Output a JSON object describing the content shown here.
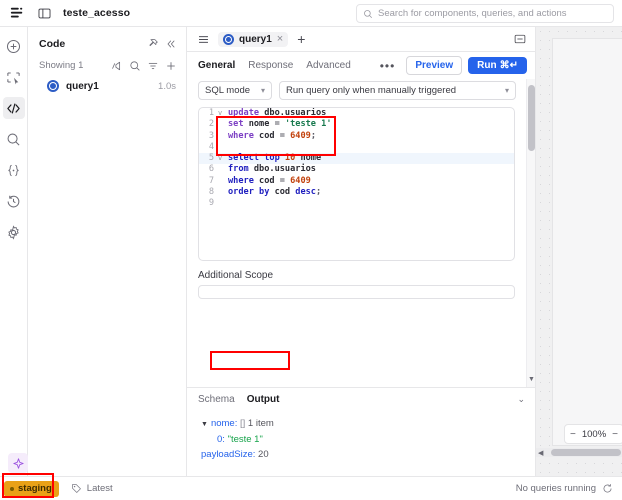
{
  "topbar": {
    "app_icon": "layers-icon",
    "panel_icon": "panel-toggle-icon",
    "title": "teste_acesso",
    "search_icon": "search-icon",
    "search_placeholder": "Search for components, queries, and actions"
  },
  "rail": {
    "items": [
      {
        "icon": "plus-circle-icon",
        "name": "add-component",
        "active": false
      },
      {
        "icon": "component-tree-icon",
        "name": "components",
        "active": false
      },
      {
        "icon": "code-brackets-icon",
        "name": "code",
        "active": true
      },
      {
        "icon": "search-icon",
        "name": "search",
        "active": false
      },
      {
        "icon": "state-braces-icon",
        "name": "state",
        "active": false
      },
      {
        "icon": "history-clock-icon",
        "name": "history",
        "active": false
      },
      {
        "icon": "gear-icon",
        "name": "settings",
        "active": false
      }
    ],
    "spark_icon": "ai-sparkle-icon"
  },
  "code_panel": {
    "title": "Code",
    "pin_icon": "pin-icon",
    "collapse_icon": "chevrons-left-icon",
    "showing_label": "Showing 1",
    "sub_icons": [
      "filter-off-icon",
      "search-icon",
      "sort-icon",
      "plus-icon"
    ],
    "items": [
      {
        "icon": "query-icon",
        "label": "query1",
        "time": "1.0s"
      }
    ]
  },
  "editor": {
    "hamburger_icon": "hamburger-icon",
    "tab": {
      "icon": "query-icon",
      "label": "query1",
      "close_icon": "close-icon"
    },
    "add_tab_icon": "plus-icon",
    "collapse_icon": "collapse-panel-icon",
    "subtabs": [
      {
        "label": "General",
        "active": true
      },
      {
        "label": "Response",
        "active": false
      },
      {
        "label": "Advanced",
        "active": false
      }
    ],
    "more_label": "•••",
    "preview_label": "Preview",
    "run_label": "Run",
    "run_shortcut": "⌘↵",
    "sql_mode_label": "SQL mode",
    "trigger_label": "Run query only when manually triggered",
    "additional_scope_label": "Additional Scope",
    "code_lines": [
      {
        "n": "1",
        "fold": "v",
        "highlight": false,
        "tokens": [
          {
            "t": "update ",
            "c": "k"
          },
          {
            "t": "dbo.usuarios",
            "c": "id"
          }
        ]
      },
      {
        "n": "2",
        "fold": "",
        "highlight": false,
        "tokens": [
          {
            "t": "set ",
            "c": "k"
          },
          {
            "t": "nome ",
            "c": "id"
          },
          {
            "t": "= ",
            "c": "op"
          },
          {
            "t": "'teste 1'",
            "c": "str"
          }
        ]
      },
      {
        "n": "3",
        "fold": "",
        "highlight": false,
        "tokens": [
          {
            "t": "where ",
            "c": "k"
          },
          {
            "t": "cod ",
            "c": "id"
          },
          {
            "t": "= ",
            "c": "op"
          },
          {
            "t": "6409",
            "c": "num"
          },
          {
            "t": ";",
            "c": "op"
          }
        ]
      },
      {
        "n": "4",
        "fold": "",
        "highlight": false,
        "tokens": []
      },
      {
        "n": "5",
        "fold": "v",
        "highlight": true,
        "tokens": [
          {
            "t": "select ",
            "c": "kb"
          },
          {
            "t": "top ",
            "c": "kb"
          },
          {
            "t": "10 ",
            "c": "num"
          },
          {
            "t": "nome",
            "c": "id"
          }
        ]
      },
      {
        "n": "6",
        "fold": "",
        "highlight": false,
        "tokens": [
          {
            "t": "from ",
            "c": "kb"
          },
          {
            "t": "dbo.usuarios",
            "c": "id"
          }
        ]
      },
      {
        "n": "7",
        "fold": "",
        "highlight": false,
        "tokens": [
          {
            "t": "where ",
            "c": "kb"
          },
          {
            "t": "cod ",
            "c": "id"
          },
          {
            "t": "= ",
            "c": "op"
          },
          {
            "t": "6409",
            "c": "num"
          }
        ]
      },
      {
        "n": "8",
        "fold": "",
        "highlight": false,
        "tokens": [
          {
            "t": "order ",
            "c": "kb"
          },
          {
            "t": "by ",
            "c": "kb"
          },
          {
            "t": "cod ",
            "c": "id"
          },
          {
            "t": "desc",
            "c": "kb"
          },
          {
            "t": ";",
            "c": "op"
          }
        ]
      },
      {
        "n": "9",
        "fold": "",
        "highlight": false,
        "tokens": []
      }
    ]
  },
  "output": {
    "tabs": [
      {
        "label": "Schema",
        "active": false
      },
      {
        "label": "Output",
        "active": true
      }
    ],
    "expand_icon": "chevrons-down-icon",
    "root_key": "nome:",
    "root_type": "[]",
    "root_count": "1 item",
    "rows": [
      {
        "index": "0:",
        "value": "\"teste 1\""
      }
    ],
    "payload_key": "payloadSize:",
    "payload_value": "20"
  },
  "canvas": {
    "zoom_minus": "−",
    "zoom_level": "100%",
    "zoom_plus": "−"
  },
  "status": {
    "environment": "staging",
    "branch_icon": "tag-icon",
    "branch_label": "Latest",
    "queries_label": "No queries running",
    "refresh_icon": "refresh-icon"
  },
  "annotations": {
    "colors": {
      "highlight": "#ff0000",
      "staging": "#e9a117",
      "accent": "#2563eb"
    },
    "boxes": [
      {
        "name": "update-statement-highlight"
      },
      {
        "name": "output-value-highlight"
      },
      {
        "name": "staging-badge-highlight"
      }
    ]
  }
}
